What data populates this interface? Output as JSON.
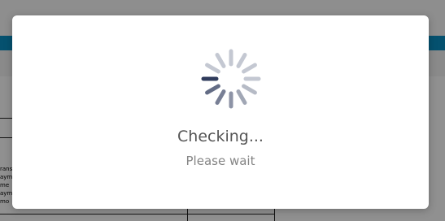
{
  "dialog": {
    "title": "Checking...",
    "subtitle": "Please wait"
  },
  "spinner": {
    "icon": "loading-spinner-icon",
    "segment_count": 12,
    "active_color": "#2f3b5c",
    "inactive_color": "#c4c8d2"
  },
  "background": {
    "accent_bar_color": "#0a8cc0",
    "table_cell_fragments": [
      "rans",
      "aym",
      "me",
      "aym",
      "mo"
    ]
  }
}
